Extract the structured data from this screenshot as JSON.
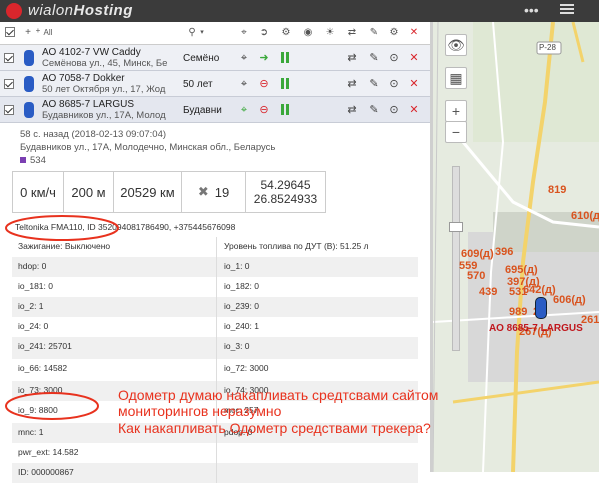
{
  "app": {
    "name_light": "wialon",
    "name_bold": "Hosting"
  },
  "columns_toolbar": {
    "all_label": "All"
  },
  "units": [
    {
      "name": "АО 4102-7 VW Caddy",
      "address": "Семёнова ул., 45, Минск, Бе",
      "driver": "Семёно"
    },
    {
      "name": "АО 7058-7 Dokker",
      "address": "50 лет Октября ул., 17, Жод",
      "driver": "50 лет"
    },
    {
      "name": "АО 8685-7 LARGUS",
      "address": "Будавников ул., 17А, Молод",
      "driver": "Будавни"
    }
  ],
  "detail": {
    "time": "58 с. назад (2018-02-13 09:07:04)",
    "address": "Будавников ул., 17А, Молодечно, Минская обл., Беларусь",
    "number": "534",
    "speed": "0 км/ч",
    "altitude": "200 м",
    "mileage": "20529 км",
    "satellites": "19",
    "lat": "54.29645",
    "lon": "26.8524933",
    "hardware": "Teltonika FMA110, ID 352094081786490, +375445676098"
  },
  "params": [
    [
      "Зажигание: Выключено",
      "Уровень топлива по ДУТ (В): 51.25 л"
    ],
    [
      "hdop: 0",
      "io_1: 0"
    ],
    [
      "io_181: 0",
      "io_182: 0"
    ],
    [
      "io_2: 1",
      "io_239: 0"
    ],
    [
      "io_24: 0",
      "io_240: 1"
    ],
    [
      "io_241: 25701",
      "io_3: 0"
    ],
    [
      "io_66: 14582",
      "io_72: 3000"
    ],
    [
      "io_73: 3000",
      "io_74: 3000"
    ],
    [
      "io_9: 8800",
      "mcc: 257"
    ],
    [
      "mnc: 1",
      "pdop: 0"
    ],
    [
      "pwr_ext: 14.582",
      ""
    ],
    [
      "ID: 000000867",
      ""
    ]
  ],
  "map": {
    "road": "P-28",
    "labels": [
      "819",
      "610(д)",
      "609(д)",
      "396",
      "559",
      "695(д)",
      "570",
      "397(д)",
      "642(д)",
      "439",
      "531",
      "606(д)",
      "989",
      "26",
      "267(д)",
      "261"
    ],
    "unit_label": "АО 8685-7 LARGUS"
  },
  "annotation": {
    "line1": "Одометр думаю накапливать средтсвами сайтом",
    "line2": "мониторингов неразумно",
    "line3": "Как накапливать Одометр средствами трекера?"
  },
  "colors": {
    "accent_red": "#e8321e",
    "unit_blue": "#2a5cc4",
    "green": "#3aa83a"
  }
}
